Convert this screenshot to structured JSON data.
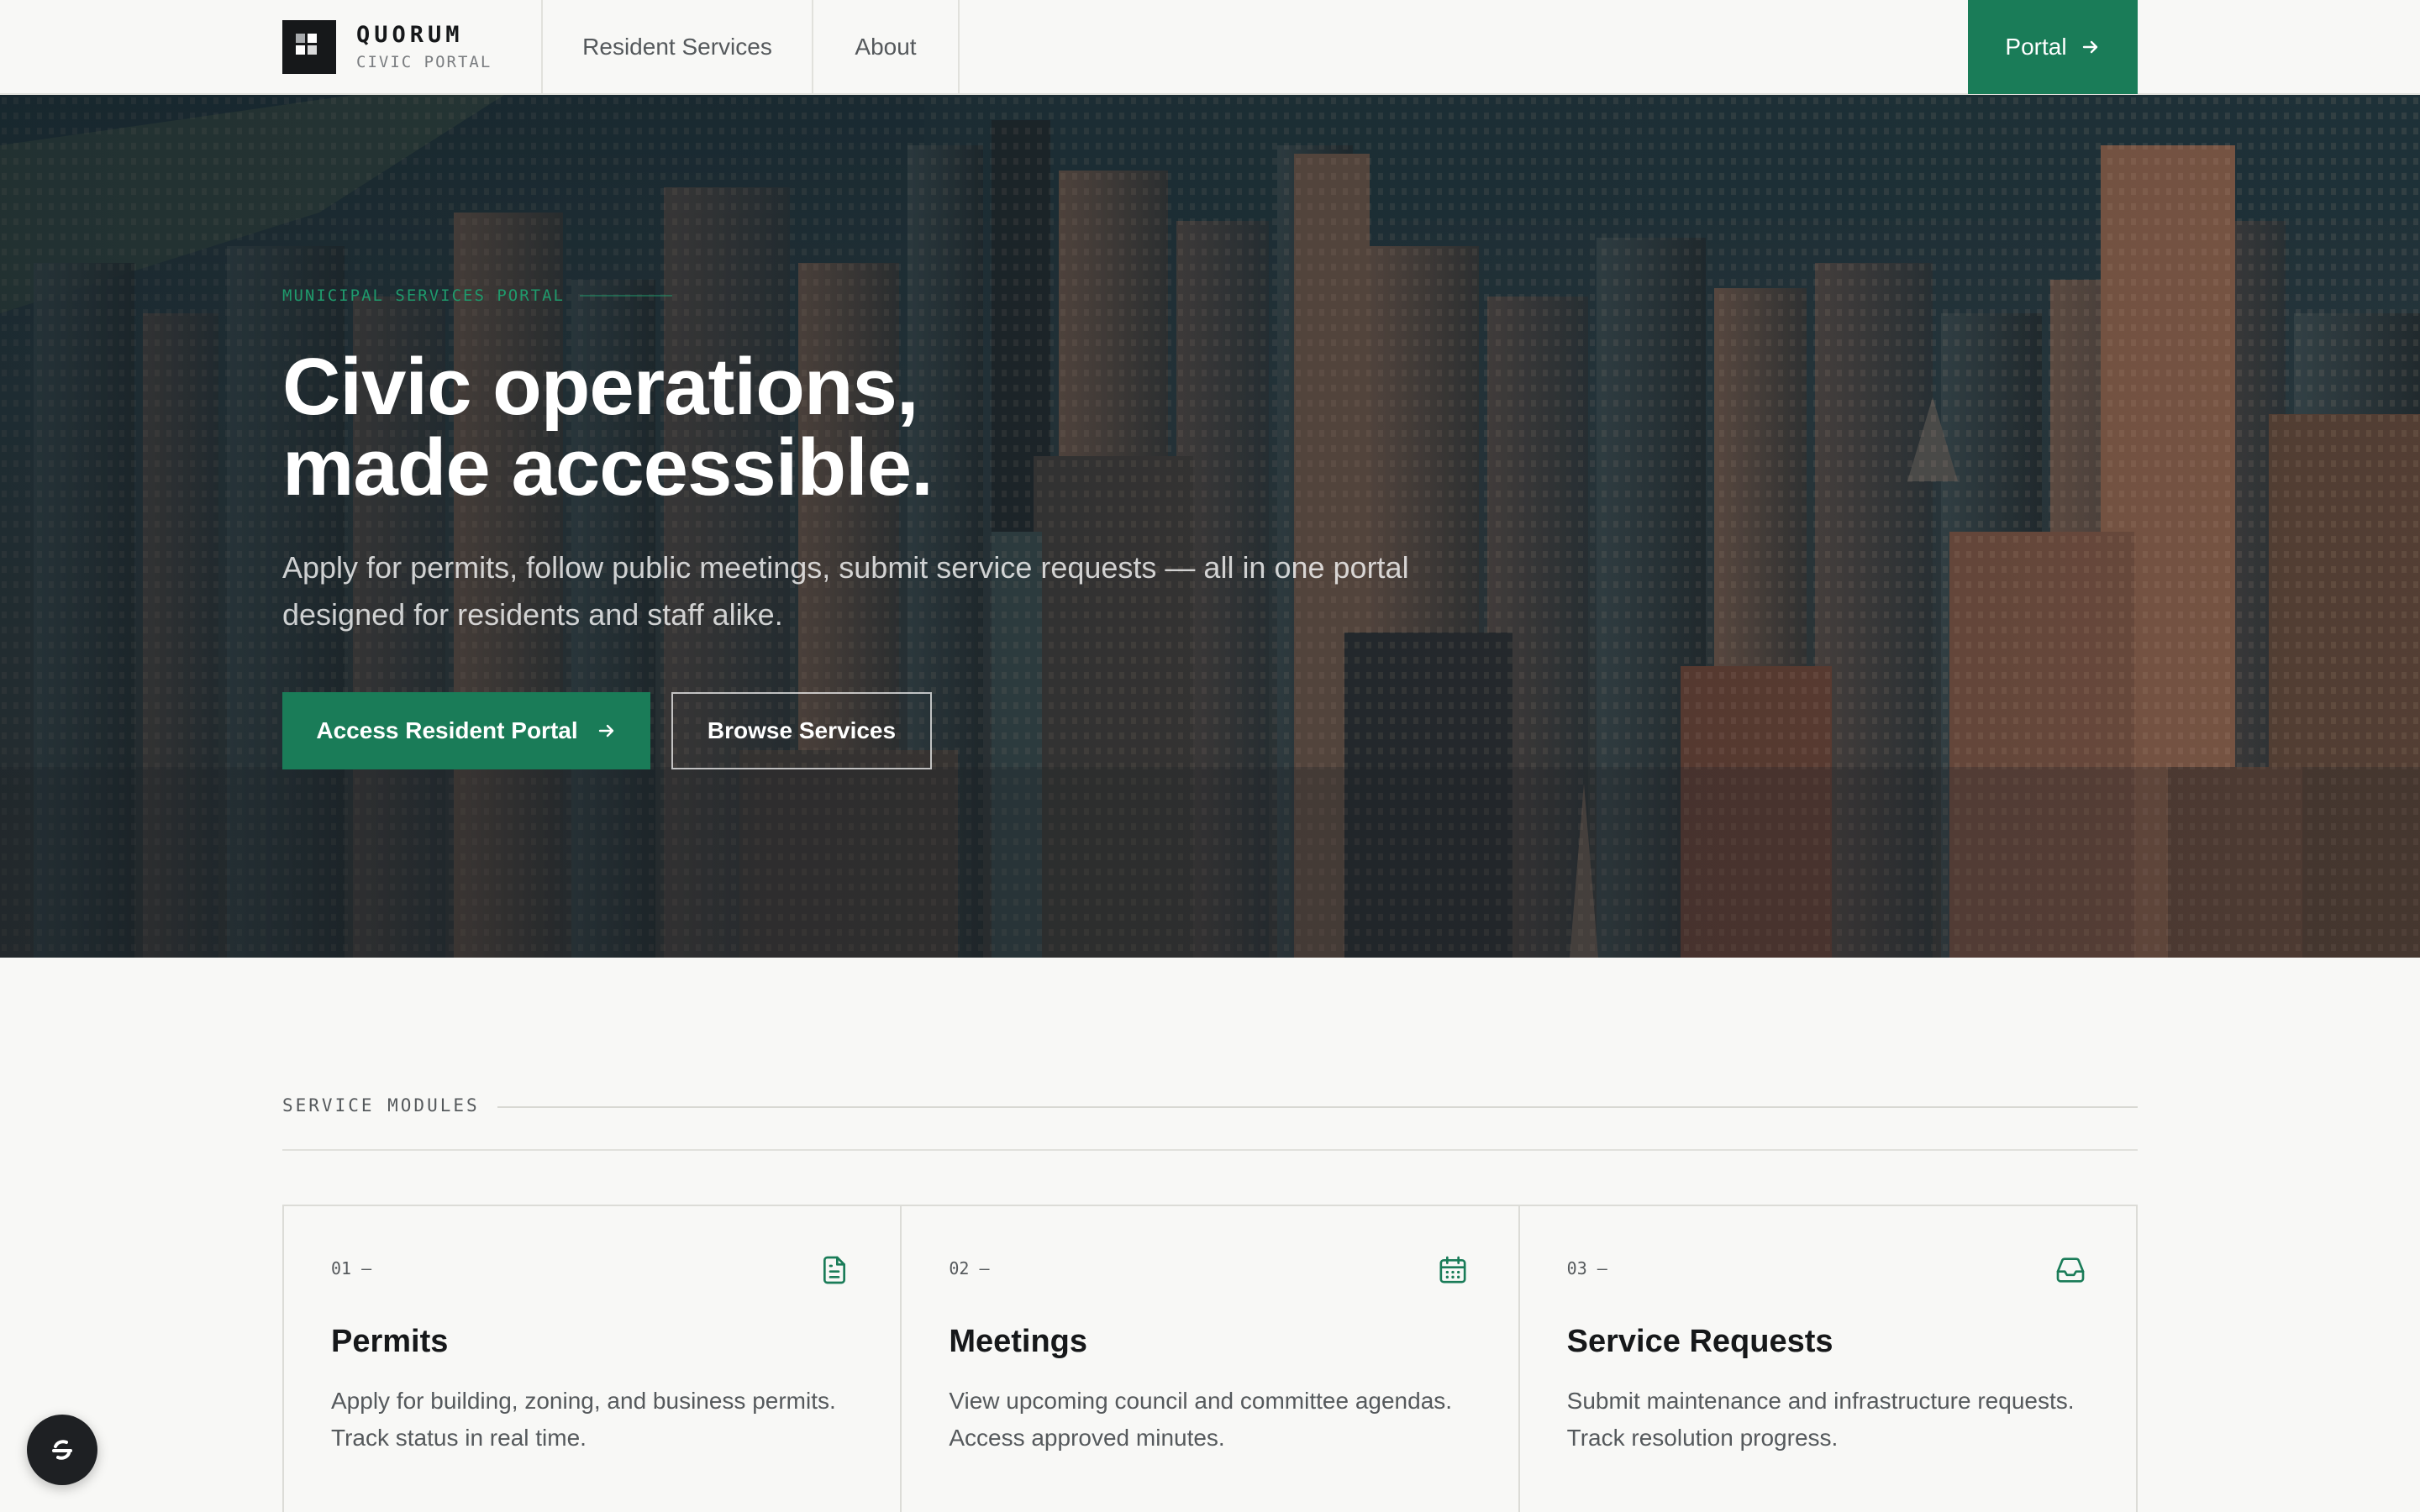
{
  "brand": {
    "name": "QUORUM",
    "subtitle": "CIVIC PORTAL",
    "icon": "quorum-grid-logo"
  },
  "nav": {
    "links": [
      {
        "label": "Resident Services"
      },
      {
        "label": "About"
      }
    ],
    "portal_label": "Portal"
  },
  "hero": {
    "eyebrow": "MUNICIPAL SERVICES PORTAL",
    "title_line1": "Civic operations,",
    "title_line2": "made accessible.",
    "subtitle": "Apply for permits, follow public meetings, submit service requests — all in one portal designed for residents and staff alike.",
    "primary_cta": "Access Resident Portal",
    "secondary_cta": "Browse Services",
    "background": "aerial-city-skyline-image"
  },
  "services": {
    "section_label": "SERVICE MODULES",
    "cards": [
      {
        "number": "01 —",
        "title": "Permits",
        "description": "Apply for building, zoning, and business permits. Track status in real time.",
        "icon": "document-icon"
      },
      {
        "number": "02 —",
        "title": "Meetings",
        "description": "View upcoming council and committee agendas. Access approved minutes.",
        "icon": "calendar-icon"
      },
      {
        "number": "03 —",
        "title": "Service Requests",
        "description": "Submit maintenance and infrastructure requests. Track resolution progress.",
        "icon": "inbox-icon"
      }
    ]
  },
  "colors": {
    "accent": "#1a7c58",
    "dark": "#16181a",
    "background": "#f8f8f6"
  }
}
